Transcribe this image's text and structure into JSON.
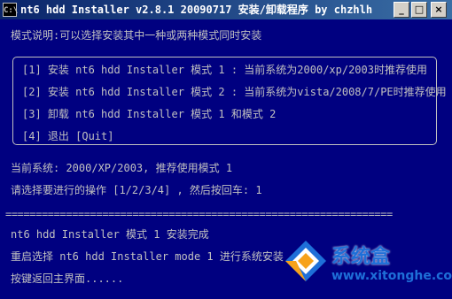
{
  "window": {
    "icon_text": "C:\\",
    "title": "nt6 hdd Installer v2.8.1 20090717 安装/卸载程序 by chzhlh",
    "buttons": {
      "minimize": "_",
      "maximize": "□",
      "close": "×"
    }
  },
  "console": {
    "mode_desc": "模式说明:可以选择安装其中一种或两种模式同时安装",
    "menu": [
      "[1] 安装 nt6 hdd Installer 模式 1 : 当前系统为2000/xp/2003时推荐使用",
      "[2] 安装 nt6 hdd Installer 模式 2 : 当前系统为vista/2008/7/PE时推荐使用",
      "[3] 卸载 nt6 hdd Installer 模式 1 和模式 2",
      "[4] 退出 [Quit]"
    ],
    "current_system": "当前系统: 2000/XP/2003, 推荐使用模式 1",
    "prompt": "请选择要进行的操作 [1/2/3/4] , 然后按回车: 1",
    "separator": "================================================================",
    "install_done": "nt6 hdd Installer 模式 1 安装完成",
    "restart_msg": "重启选择 nt6 hdd Installer mode 1 进行系统安装",
    "return_msg": "按键返回主界面......"
  },
  "watermark": {
    "name": "系统盒",
    "url": "www.xitonghe.com",
    "colors": {
      "primary": "#1e6fd8",
      "accent": "#f7a21b"
    }
  },
  "colors": {
    "console_bg": "#000080",
    "console_fg": "#c0c0c0"
  }
}
